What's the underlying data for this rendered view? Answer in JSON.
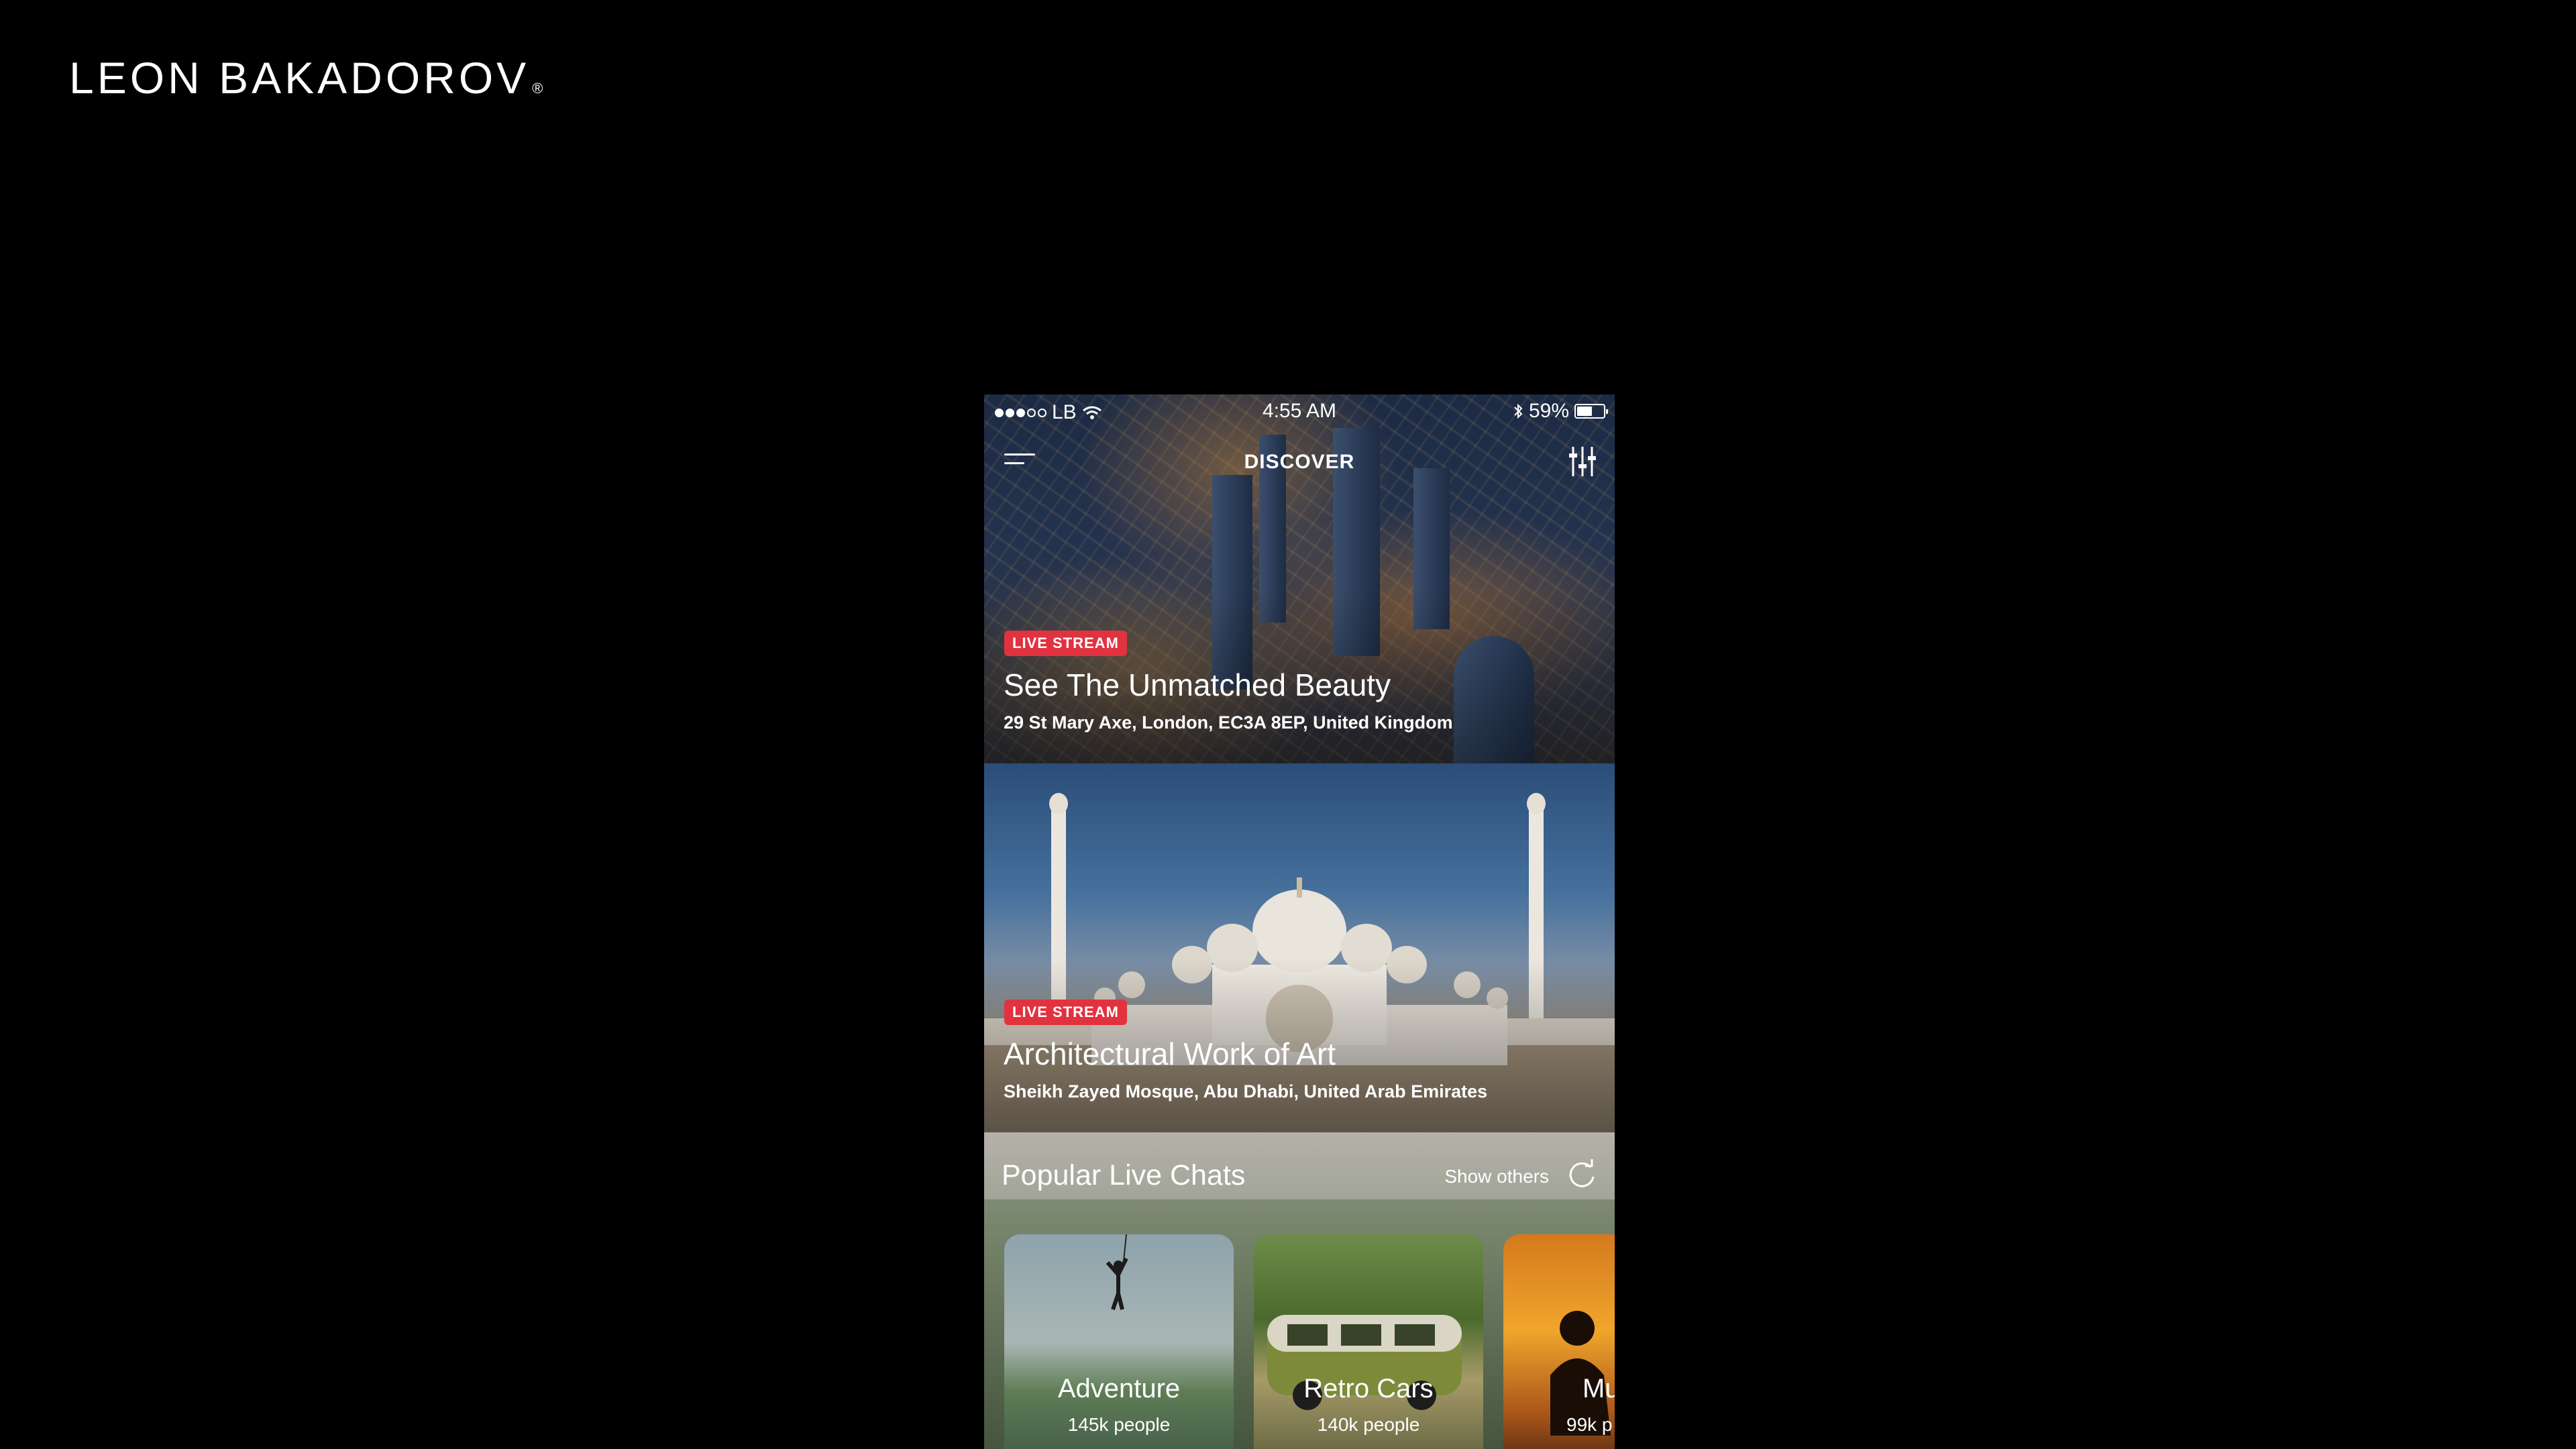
{
  "brand": {
    "name": "LEON BAKADOROV",
    "mark": "®"
  },
  "statusbar": {
    "carrier": "LB",
    "time": "4:55 AM",
    "battery": "59%",
    "battery_level": 0.59
  },
  "navbar": {
    "title": "DISCOVER"
  },
  "cards": [
    {
      "badge": "LIVE STREAM",
      "title": "See The Unmatched Beauty",
      "subtitle": "29 St Mary Axe, London, EC3A 8EP, United Kingdom"
    },
    {
      "badge": "LIVE STREAM",
      "title": "Architectural Work of Art",
      "subtitle": "Sheikh Zayed Mosque, Abu Dhabi, United Arab Emirates"
    }
  ],
  "popular": {
    "title": "Popular Live Chats",
    "show_others": "Show others",
    "chats": [
      {
        "name": "Adventure",
        "count": "145k people"
      },
      {
        "name": "Retro Cars",
        "count": "140k people"
      },
      {
        "name": "Mu",
        "count": "99k p"
      }
    ]
  }
}
